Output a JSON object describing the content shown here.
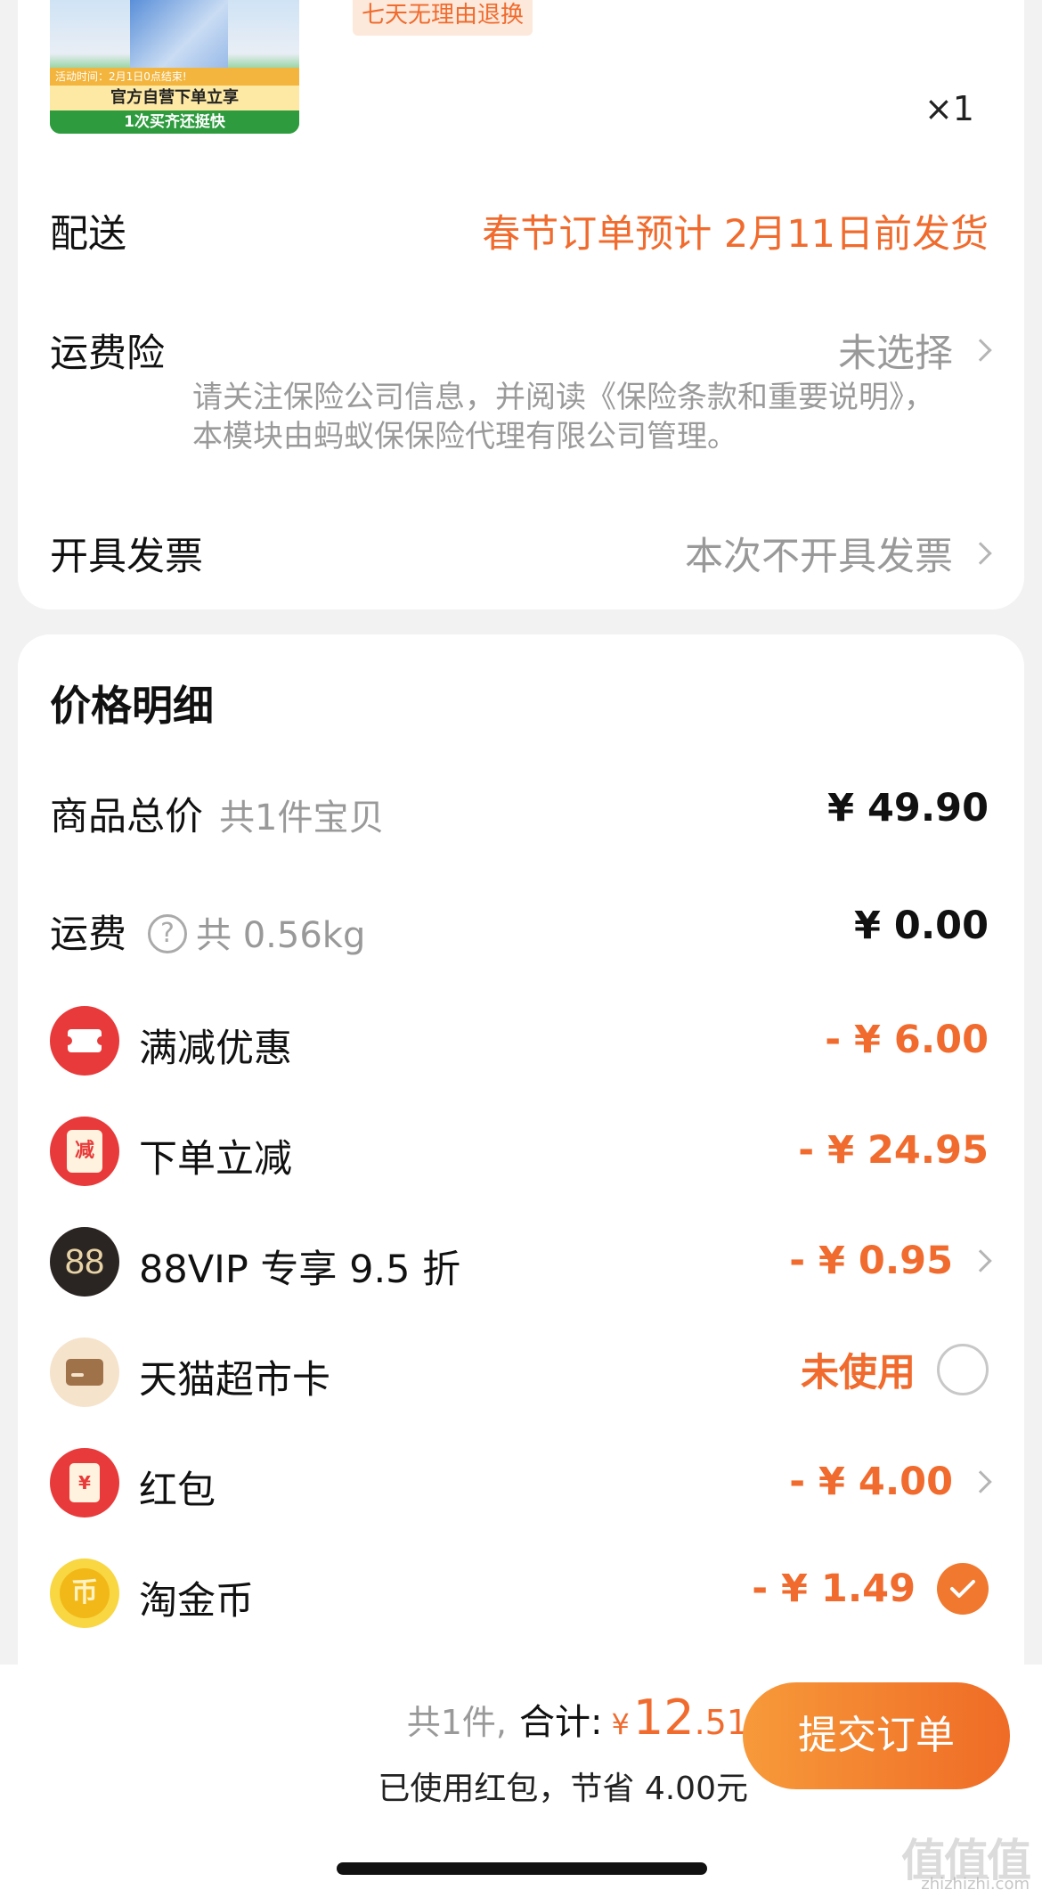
{
  "product": {
    "thumb_activity": "活动时间：2月1日0点结束!",
    "thumb_line1": "官方自营下单立享",
    "thumb_line2": "1次买齐还挺快",
    "service_tag": "七天无理由退换",
    "quantity": "×1"
  },
  "delivery": {
    "label": "配送",
    "value": "春节订单预计 2月11日前发货"
  },
  "shipping_insurance": {
    "label": "运费险",
    "value": "未选择",
    "note": "请关注保险公司信息，并阅读《保险条款和重要说明》，本模块由蚂蚁保保险代理有限公司管理。"
  },
  "invoice": {
    "label": "开具发票",
    "value": "本次不开具发票"
  },
  "price_detail": {
    "title": "价格明细",
    "goods_total": {
      "label": "商品总价",
      "sub": "共1件宝贝",
      "value": "¥ 49.90"
    },
    "freight": {
      "label": "运费",
      "help": "?",
      "sub": "共 0.56kg",
      "value": "¥ 0.00"
    },
    "discounts": [
      {
        "icon": "coupon-icon",
        "label": "满减优惠",
        "value": "- ¥ 6.00",
        "chevron": false,
        "control": "none"
      },
      {
        "icon": "reduce-icon",
        "icon_text": "减",
        "label": "下单立减",
        "value": "- ¥ 24.95",
        "chevron": false,
        "control": "none"
      },
      {
        "icon": "vip88-icon",
        "icon_text": "88",
        "label": "88VIP 专享 9.5 折",
        "value": "- ¥ 0.95",
        "chevron": true,
        "control": "none"
      },
      {
        "icon": "supermarket-card-icon",
        "label": "天猫超市卡",
        "value": "未使用",
        "chevron": false,
        "control": "radio-empty"
      },
      {
        "icon": "red-packet-icon",
        "icon_text": "¥",
        "label": "红包",
        "value": "- ¥ 4.00",
        "chevron": true,
        "control": "none"
      },
      {
        "icon": "gold-coin-icon",
        "icon_text": "币",
        "label": "淘金币",
        "value": "- ¥ 1.49",
        "chevron": false,
        "control": "radio-checked"
      }
    ]
  },
  "bottom_bar": {
    "count": "共1件,",
    "total_label": "合计:",
    "currency": "¥",
    "total_int": "12",
    "total_dec": ".51",
    "saved": "已使用红包，节省 4.00元",
    "submit": "提交订单"
  },
  "watermark": {
    "main": "值值值",
    "sub": "zhizhizhi.com"
  },
  "colors": {
    "accent": "#f06b2d",
    "discount_red": "#e83a3a",
    "muted": "#999999"
  }
}
